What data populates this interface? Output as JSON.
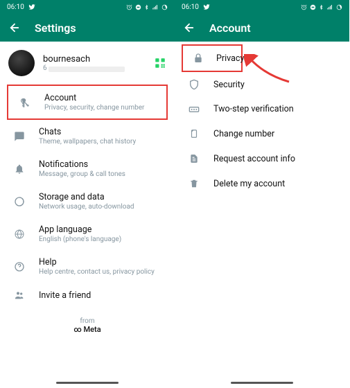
{
  "status": {
    "time": "06:10"
  },
  "left": {
    "title": "Settings",
    "profile": {
      "name": "bournesach",
      "status_char": "6"
    },
    "items": [
      {
        "label": "Account",
        "sub": "Privacy, security, change number"
      },
      {
        "label": "Chats",
        "sub": "Theme, wallpapers, chat history"
      },
      {
        "label": "Notifications",
        "sub": "Message, group & call tones"
      },
      {
        "label": "Storage and data",
        "sub": "Network usage, auto-download"
      },
      {
        "label": "App language",
        "sub": "English (phone's language)"
      },
      {
        "label": "Help",
        "sub": "Help centre, contact us, privacy policy"
      },
      {
        "label": "Invite a friend",
        "sub": ""
      }
    ],
    "footer_from": "from",
    "footer_brand": "Meta"
  },
  "right": {
    "title": "Account",
    "items": [
      {
        "label": "Privacy"
      },
      {
        "label": "Security"
      },
      {
        "label": "Two-step verification"
      },
      {
        "label": "Change number"
      },
      {
        "label": "Request account info"
      },
      {
        "label": "Delete my account"
      }
    ]
  }
}
